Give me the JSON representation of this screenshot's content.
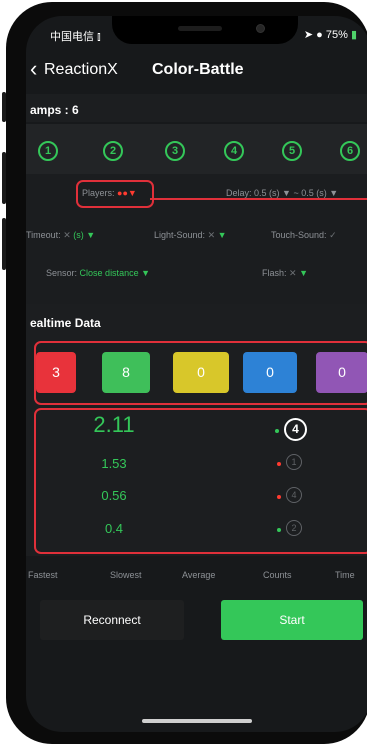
{
  "status_bar": {
    "carrier": "中国电信",
    "battery": "75%"
  },
  "nav": {
    "back_label": "ReactionX",
    "title": "Color-Battle"
  },
  "lamps": {
    "title": "amps : 6",
    "items": [
      "1",
      "2",
      "3",
      "4",
      "5",
      "6"
    ]
  },
  "options": {
    "players_label": "Players:",
    "delay_label": "Delay:",
    "delay_value": "0.5 (s) ▼ ~ 0.5 (s) ▼",
    "timeout_label": "Timeout:",
    "timeout_value": "(s) ▼",
    "light_sound_label": "Light-Sound:",
    "touch_sound_label": "Touch-Sound:",
    "sensor_label": "Sensor:",
    "sensor_value": "Close distance ▼",
    "flash_label": "Flash:"
  },
  "realtime": {
    "title": "ealtime Data",
    "scores": [
      {
        "value": "3",
        "color": "#e8333b"
      },
      {
        "value": "8",
        "color": "#3fbf5a"
      },
      {
        "value": "0",
        "color": "#d8c72a"
      },
      {
        "value": "0",
        "color": "#2d82d6"
      },
      {
        "value": "0",
        "color": "#9156b5"
      }
    ],
    "times": [
      "2.11",
      "1.53",
      "0.56",
      "0.4"
    ],
    "lamp_markers": [
      {
        "num": "4",
        "dot_color": "#34c759"
      },
      {
        "num": "1",
        "dot_color": "#ff3b30"
      },
      {
        "num": "4",
        "dot_color": "#ff3b30"
      },
      {
        "num": "2",
        "dot_color": "#34c759"
      }
    ]
  },
  "stats_labels": [
    "Fastest",
    "Slowest",
    "Average",
    "Counts",
    "Time"
  ],
  "buttons": {
    "reconnect": "Reconnect",
    "start": "Start"
  },
  "colors": {
    "accent_green": "#34c759",
    "highlight_red": "#e0303a"
  }
}
